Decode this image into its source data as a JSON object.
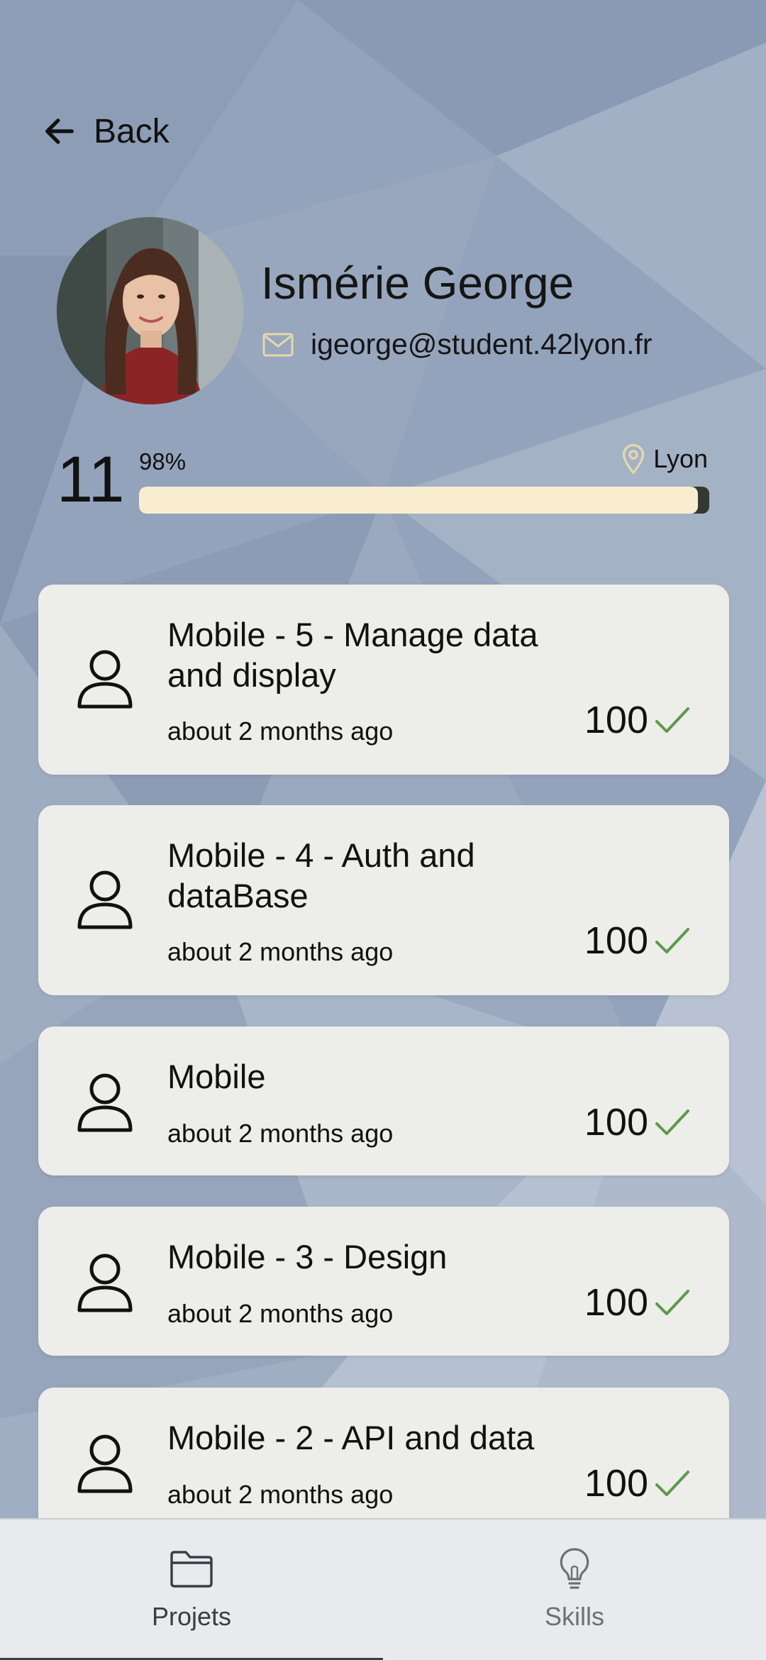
{
  "header": {
    "back_label": "Back"
  },
  "profile": {
    "name": "Ismérie George",
    "email": "igeorge@student.42lyon.fr",
    "level": "11",
    "level_progress_label": "98%",
    "level_progress": 0.98,
    "location": "Lyon"
  },
  "projects": [
    {
      "title": "Mobile - 5 - Manage data and display",
      "time": "about 2 months ago",
      "score": "100",
      "validated": true
    },
    {
      "title": "Mobile - 4 - Auth and dataBase",
      "time": "about 2 months ago",
      "score": "100",
      "validated": true
    },
    {
      "title": "Mobile",
      "time": "about 2 months ago",
      "score": "100",
      "validated": true
    },
    {
      "title": "Mobile - 3 - Design",
      "time": "about 2 months ago",
      "score": "100",
      "validated": true
    },
    {
      "title": "Mobile - 2 - API and data",
      "time": "about 2 months ago",
      "score": "100",
      "validated": true
    }
  ],
  "icons": {
    "back": "arrow-left-icon",
    "email": "mail-icon",
    "location": "map-pin-icon",
    "project": "person-icon",
    "validated": "check-icon",
    "projects_tab": "folder-icon",
    "skills_tab": "lightbulb-icon"
  },
  "colors": {
    "background": "#8f9fb8",
    "card": "#ededea",
    "progress_fill": "#f8edcf",
    "progress_track": "#333830",
    "check": "#5a9a48",
    "bottom_nav": "#e8eaed"
  },
  "bottom_nav": {
    "tabs": [
      {
        "label": "Projets",
        "active": true
      },
      {
        "label": "Skills",
        "active": false
      }
    ]
  }
}
